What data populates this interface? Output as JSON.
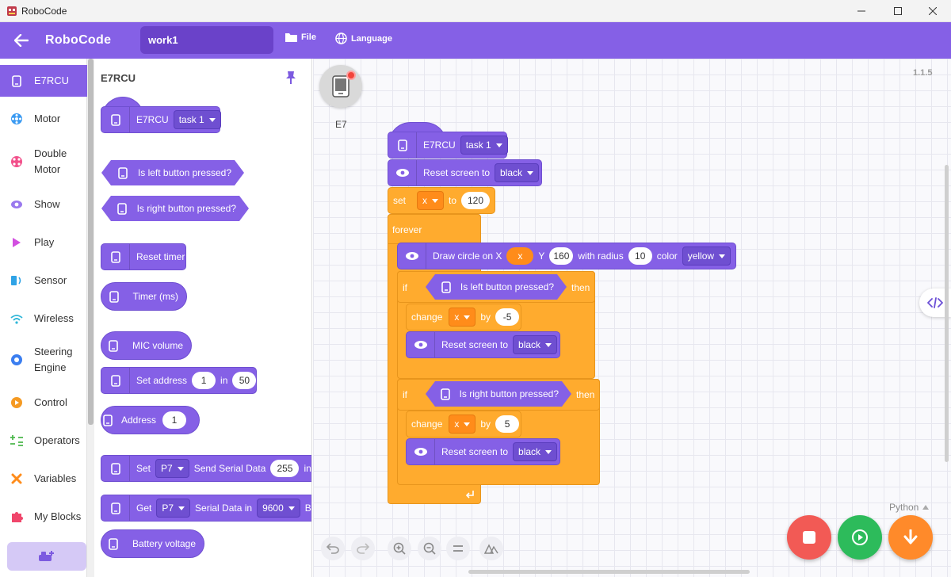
{
  "window": {
    "title": "RoboCode"
  },
  "topbar": {
    "brand": "RoboCode",
    "project_name": "work1",
    "file_label": "File",
    "language_label": "Language",
    "color": "#8560e6"
  },
  "categories": [
    {
      "label": "E7RCU",
      "icon": "device-icon",
      "active": true
    },
    {
      "label": "Motor",
      "icon": "motor-icon"
    },
    {
      "label": "Double Motor",
      "icon": "double-motor-icon"
    },
    {
      "label": "Show",
      "icon": "eye-icon"
    },
    {
      "label": "Play",
      "icon": "play-icon"
    },
    {
      "label": "Sensor",
      "icon": "sensor-icon"
    },
    {
      "label": "Wireless",
      "icon": "wifi-icon"
    },
    {
      "label": "Steering Engine",
      "icon": "steering-icon"
    },
    {
      "label": "Control",
      "icon": "control-icon"
    },
    {
      "label": "Operators",
      "icon": "operators-icon"
    },
    {
      "label": "Variables",
      "icon": "variables-icon"
    },
    {
      "label": "My Blocks",
      "icon": "puzzle-icon"
    }
  ],
  "palette": {
    "title": "E7RCU",
    "hat": {
      "label": "E7RCU",
      "task": "task 1"
    },
    "left_button": "Is left button pressed?",
    "right_button": "Is right button pressed?",
    "reset_timer": "Reset timer",
    "timer": "Timer (ms)",
    "mic": "MIC volume",
    "set_address": {
      "label": "Set address",
      "value": "1",
      "in": "in",
      "channel": "50"
    },
    "address": {
      "label": "Address",
      "value": "1"
    },
    "serial_send": {
      "set": "Set",
      "port": "P7",
      "label": "Send Serial Data",
      "value": "255",
      "in": "in"
    },
    "serial_get": {
      "get": "Get",
      "port": "P7",
      "label": "Serial Data in",
      "baud": "9600",
      "suffix": "B"
    },
    "battery": "Battery voltage"
  },
  "canvas": {
    "version": "1.1.5",
    "device": {
      "name": "E7",
      "status_color": "#f2443b"
    },
    "script": {
      "hat_label": "E7RCU",
      "hat_task": "task 1",
      "reset1": {
        "label": "Reset screen to",
        "color": "black"
      },
      "set_var": {
        "set": "set",
        "var": "x",
        "to": "to",
        "value": "120"
      },
      "forever": "forever",
      "circle": {
        "label": "Draw circle on X",
        "x": "x",
        "y_label": "Y",
        "y": "160",
        "radius_label": "with radius",
        "radius": "10",
        "color_label": "color",
        "color": "yellow"
      },
      "if1": {
        "if": "if",
        "condition": "Is left button pressed?",
        "then": "then"
      },
      "change1": {
        "change": "change",
        "var": "x",
        "by": "by",
        "value": "-5"
      },
      "reset2": {
        "label": "Reset screen to",
        "color": "black"
      },
      "if2": {
        "if": "if",
        "condition": "Is right button pressed?",
        "then": "then"
      },
      "change2": {
        "change": "change",
        "var": "x",
        "by": "by",
        "value": "5"
      },
      "reset3": {
        "label": "Reset screen to",
        "color": "black"
      }
    },
    "language_label": "Python"
  },
  "actions": {
    "stop_color": "#f25a55",
    "run_color": "#2dbb5b",
    "download_color": "#ff8a2a"
  }
}
